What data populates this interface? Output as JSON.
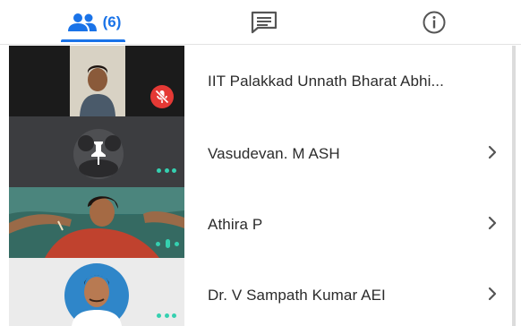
{
  "tabs": {
    "people": {
      "icon": "people-icon",
      "count_label": "(6)"
    },
    "chat": {
      "icon": "chat-icon"
    },
    "info": {
      "icon": "info-icon"
    },
    "active": "people",
    "accent_color": "#1a73e8"
  },
  "participants": [
    {
      "name": "IIT Palakkad Unnath Bharat Abhi...",
      "muted": true,
      "has_chevron": false,
      "status_icon": "mic-off-icon"
    },
    {
      "name": "Vasudevan. M ASH",
      "pinned": true,
      "has_chevron": true,
      "status_icon": "more-options-dots-icon"
    },
    {
      "name": "Athira P",
      "has_chevron": true,
      "status_icon": "audio-level-icon"
    },
    {
      "name": "Dr. V Sampath Kumar AEI",
      "has_chevron": true,
      "status_icon": "more-options-dots-icon"
    }
  ],
  "colors": {
    "mute_badge": "#e53935",
    "indicator_teal": "#35d0b0",
    "text": "#2b2b2b"
  }
}
